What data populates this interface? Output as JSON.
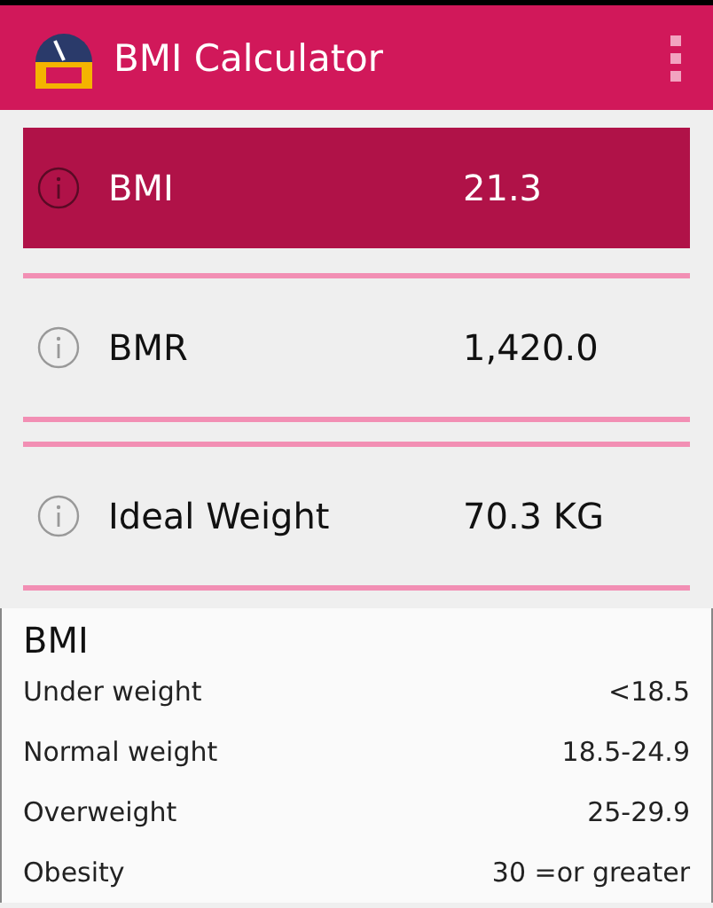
{
  "app_bar": {
    "title": "BMI Calculator"
  },
  "results": [
    {
      "label": "BMI",
      "value": "21.3",
      "selected": true
    },
    {
      "label": "BMR",
      "value": "1,420.0",
      "selected": false
    },
    {
      "label": "Ideal Weight",
      "value": "70.3 KG",
      "selected": false
    }
  ],
  "reference": {
    "heading": "BMI",
    "rows": [
      {
        "category": "Under weight",
        "range": "<18.5"
      },
      {
        "category": "Normal weight",
        "range": "18.5-24.9"
      },
      {
        "category": "Overweight",
        "range": "25-29.9"
      },
      {
        "category": "Obesity",
        "range": "30 =or greater"
      }
    ]
  }
}
